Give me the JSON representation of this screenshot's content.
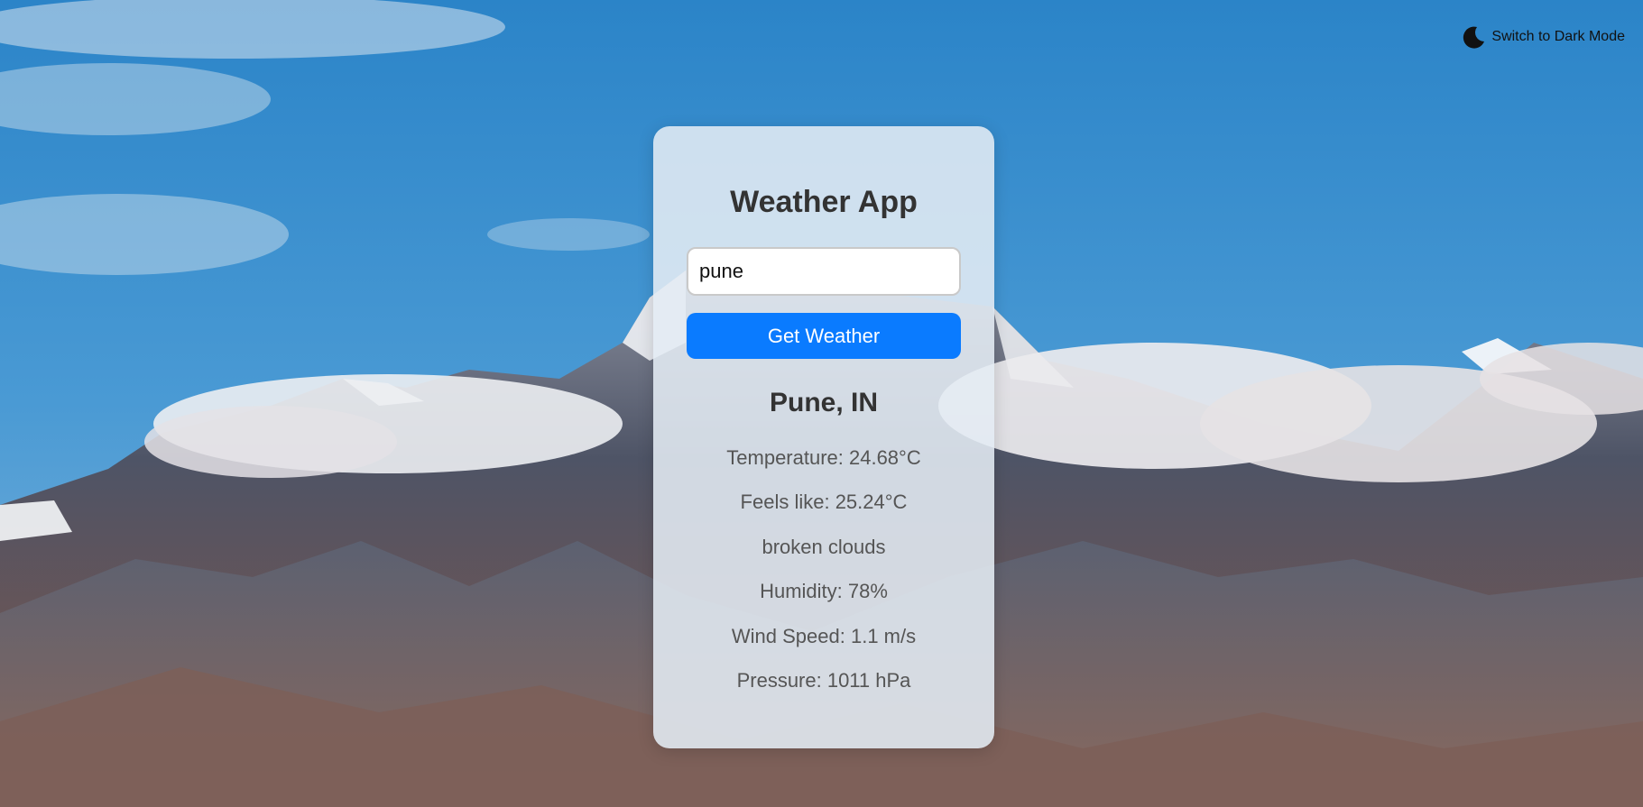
{
  "theme_toggle": {
    "label": "Switch to Dark Mode",
    "icon": "moon-icon"
  },
  "app": {
    "title": "Weather App",
    "search": {
      "value": "pune"
    },
    "button_label": "Get Weather"
  },
  "result": {
    "location": "Pune, IN",
    "temperature": "Temperature: 24.68°C",
    "feels_like": "Feels like: 25.24°C",
    "description": "broken clouds",
    "humidity": "Humidity: 78%",
    "wind": "Wind Speed: 1.1 m/s",
    "pressure": "Pressure: 1011 hPa"
  },
  "colors": {
    "accent": "#0a7bff",
    "heading": "#333333",
    "stat_text": "#555555"
  }
}
